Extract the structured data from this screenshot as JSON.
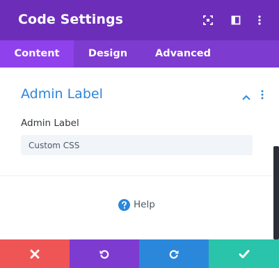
{
  "header": {
    "title": "Code Settings",
    "bg_color": "#6c2eb9",
    "icons": [
      "expand-icon",
      "sidebar-toggle-icon",
      "more-options-icon"
    ]
  },
  "tabs": [
    {
      "label": "Content",
      "active": true
    },
    {
      "label": "Design",
      "active": false
    },
    {
      "label": "Advanced",
      "active": false
    }
  ],
  "section": {
    "title": "Admin Label",
    "accent_color": "#2b87da",
    "icons": [
      "chevron-up-icon",
      "more-options-icon"
    ]
  },
  "field": {
    "label": "Admin Label",
    "value": "Custom CSS"
  },
  "help": {
    "label": "Help"
  },
  "footer": {
    "buttons": [
      {
        "name": "cancel",
        "icon": "close-icon",
        "color": "#ef5555"
      },
      {
        "name": "undo",
        "icon": "undo-icon",
        "color": "#7e3bd0"
      },
      {
        "name": "redo",
        "icon": "redo-icon",
        "color": "#2b87da"
      },
      {
        "name": "save",
        "icon": "check-icon",
        "color": "#29c4a9"
      }
    ]
  }
}
